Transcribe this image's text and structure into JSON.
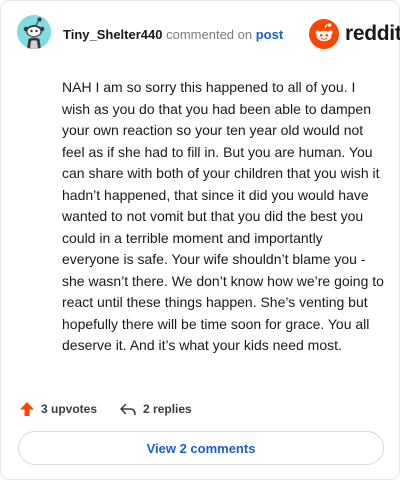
{
  "header": {
    "username": "Tiny_Shelter440",
    "action_text": "commented on",
    "post_link": "post",
    "logo_text": "reddit"
  },
  "comment": {
    "body": "NAH I am so sorry this happened to all of you. I wish as you do that you had been able to dampen your own reaction so your ten year old would not feel as if she had to fill in. But you are human. You can share with both of your children that you wish it hadn’t happened, that since it did you would have wanted to not vomit but that you did the best you could in a terrible moment and importantly everyone is safe. Your wife shouldn’t blame you - she wasn’t there. We don’t know how we’re going to react until these things happen. She’s venting but hopefully there will be time soon for grace. You all deserve it. And it’s what your kids need most."
  },
  "actions": {
    "upvotes": "3 upvotes",
    "replies": "2 replies"
  },
  "footer": {
    "view_comments": "View 2 comments"
  },
  "colors": {
    "accent": "#1a5fcc",
    "upvote": "#ff4500",
    "avatar_bg": "#7fdde0"
  },
  "icons": {
    "avatar": "snoo-avatar-icon",
    "logo": "reddit-logo-icon",
    "upvote": "upvote-arrow-icon",
    "reply": "reply-arrow-icon"
  }
}
